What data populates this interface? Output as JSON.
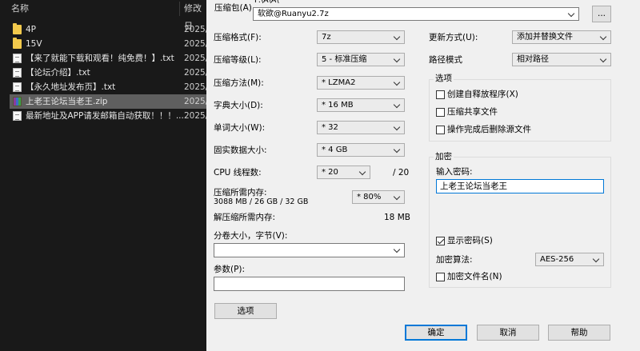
{
  "explorer": {
    "col_name": "名称",
    "col_date": "修改日",
    "files": [
      {
        "name": "4P",
        "type": "folder",
        "date": "2025/"
      },
      {
        "name": "15V",
        "type": "folder",
        "date": "2025/"
      },
      {
        "name": "【来了就能下载和观看！纯免费！】.txt",
        "type": "txt",
        "date": "2025/"
      },
      {
        "name": "【论坛介绍】.txt",
        "type": "txt",
        "date": "2025/"
      },
      {
        "name": "【永久地址发布页】.txt",
        "type": "txt",
        "date": "2025/"
      },
      {
        "name": "上老王论坛当老王.zip",
        "type": "zip",
        "date": "2025/",
        "selected": true
      },
      {
        "name": "最新地址及APP请发邮箱自动获取！！！...",
        "type": "txt",
        "date": "2025/"
      }
    ]
  },
  "dialog": {
    "path_text": "F:\\A\\A\\",
    "archive_label": "压缩包(A)",
    "archive_value": "软欲@Ruanyu2.7z",
    "browse_label": "...",
    "format_label": "压缩格式(F):",
    "format_value": "7z",
    "level_label": "压缩等级(L):",
    "level_value": "5 - 标准压缩",
    "method_label": "压缩方法(M):",
    "method_value": "* LZMA2",
    "dict_label": "字典大小(D):",
    "dict_value": "* 16 MB",
    "word_label": "单词大小(W):",
    "word_value": "* 32",
    "solid_label": "固实数据大小:",
    "solid_value": "* 4 GB",
    "cpu_label": "CPU 线程数:",
    "cpu_value": "* 20",
    "cpu_total": "/ 20",
    "mem_compress_label": "压缩所需内存:",
    "mem_compress_value": "3088 MB / 26 GB / 32 GB",
    "mem_percent": "* 80%",
    "mem_decompress_label": "解压缩所需内存:",
    "mem_decompress_value": "18 MB",
    "split_label": "分卷大小，字节(V):",
    "split_value": "",
    "params_label": "参数(P):",
    "params_value": "",
    "options_button": "选项",
    "update_label": "更新方式(U):",
    "update_value": "添加并替换文件",
    "path_mode_label": "路径模式",
    "path_mode_value": "相对路径",
    "options_group": "选项",
    "opt_sfx": "创建自释放程序(X)",
    "opt_shared": "压缩共享文件",
    "opt_delete": "操作完成后删除源文件",
    "encrypt_group": "加密",
    "password_label": "输入密码:",
    "password_value": "上老王论坛当老王",
    "show_password": "显示密码(S)",
    "enc_method_label": "加密算法:",
    "enc_method_value": "AES-256",
    "encrypt_names": "加密文件名(N)",
    "ok_button": "确定",
    "cancel_button": "取消",
    "help_button": "帮助"
  }
}
